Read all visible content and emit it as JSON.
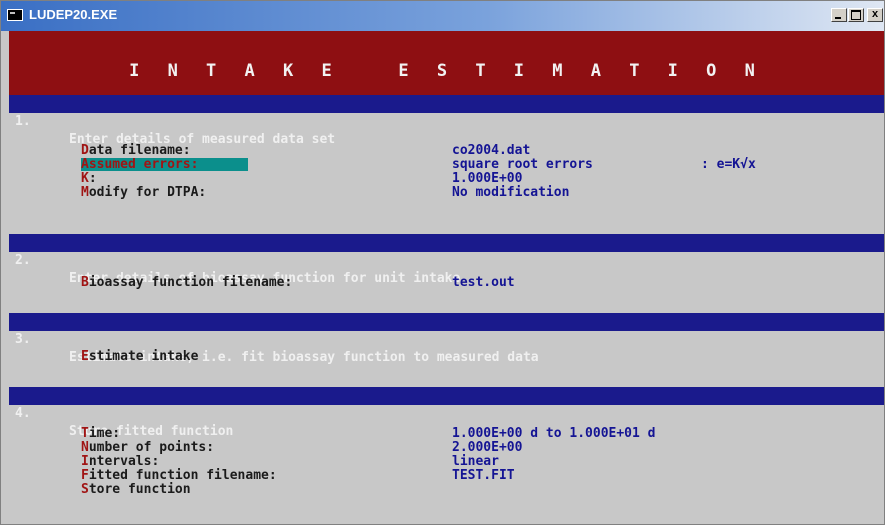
{
  "window": {
    "title": "LUDEP20.EXE",
    "minimize_label": "_",
    "maximize_label": "□",
    "close_label": "x"
  },
  "header": {
    "title": "I N T A K E   E S T I M A T I O N"
  },
  "sections": [
    {
      "number": "1.",
      "title": "Enter details of measured data set"
    },
    {
      "number": "2.",
      "title": "Enter details of bioassay function for unit intake"
    },
    {
      "number": "3.",
      "title": "Estimate intake, i.e. fit bioassay function to measured data"
    },
    {
      "number": "4.",
      "title": "Store fitted function"
    }
  ],
  "section1": {
    "data_filename": {
      "hotkey": "D",
      "label": "ata filename:",
      "value": "co2004.dat"
    },
    "assumed_errors": {
      "hotkey": "A",
      "label": "ssumed errors:",
      "value": "square root errors",
      "formula": ": e=K√x"
    },
    "k": {
      "hotkey": "K",
      "label": ":",
      "value": "1.000E+00"
    },
    "dtpa": {
      "hotkey": "M",
      "label": "odify for DTPA:",
      "value": "No modification"
    }
  },
  "section2": {
    "bioassay": {
      "hotkey": "B",
      "label": "ioassay function filename:",
      "value": "test.out"
    }
  },
  "section3": {
    "estimate": {
      "hotkey": "E",
      "label": "stimate intake"
    }
  },
  "section4": {
    "time": {
      "hotkey": "T",
      "label": "ime:",
      "value": "1.000E+00 d to 1.000E+01 d"
    },
    "points": {
      "hotkey": "N",
      "label": "umber of points:",
      "value": "2.000E+00"
    },
    "intervals": {
      "hotkey": "I",
      "label": "ntervals:",
      "value": "linear"
    },
    "fitted": {
      "hotkey": "F",
      "label": "itted function filename:",
      "value": "TEST.FIT"
    },
    "store": {
      "hotkey": "S",
      "label": "tore function"
    }
  },
  "colors": {
    "header_bg": "#8e0f12",
    "section_bar_bg": "#1a1a8c",
    "console_bg": "#c8c8c8",
    "hotkey": "#a01414",
    "value_text": "#141494",
    "highlight": "#0b8f8c"
  },
  "icons": {
    "app": "dos-console-icon"
  }
}
